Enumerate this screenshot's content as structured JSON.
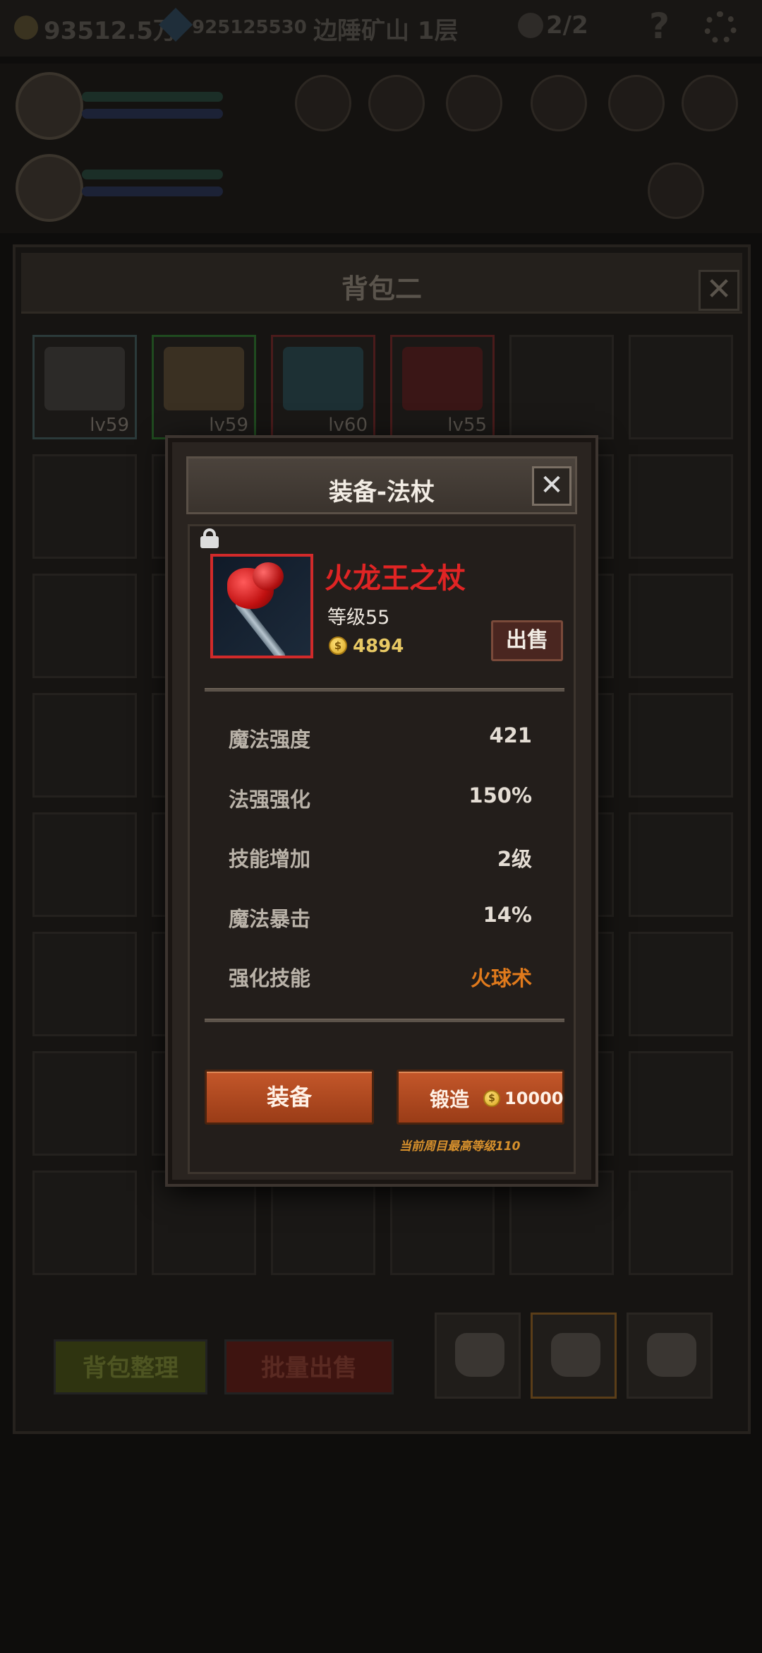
{
  "topbar": {
    "gold": "93512.5万",
    "gems": "925125530",
    "location": "边陲矿山 1层",
    "skull_count": "2/2",
    "help": "?"
  },
  "bag_panel": {
    "title": "背包二",
    "close": "✕",
    "filled_slots": [
      {
        "level": "lv59",
        "icon": "gun-icon",
        "rarity_color": "#2b3a3a"
      },
      {
        "level": "lv59",
        "icon": "dice-icon",
        "rarity_color": "#1f4a1f"
      },
      {
        "level": "lv60",
        "icon": "dagger-icon",
        "rarity_color": "#4a1b1b"
      },
      {
        "level": "lv55",
        "icon": "staff-icon",
        "rarity_color": "#4a1b1b"
      }
    ],
    "sort_label": "背包整理",
    "bulk_sell_label": "批量出售"
  },
  "dialog": {
    "title": "装备-法杖",
    "close": "✕",
    "item": {
      "name": "火龙王之杖",
      "level_text": "等级55",
      "price": "4894",
      "rarity_color": "#d12a2a",
      "locked": true
    },
    "sell_label": "出售",
    "stats": [
      {
        "label": "魔法强度",
        "value": "421"
      },
      {
        "label": "法强强化",
        "value": "150%"
      },
      {
        "label": "技能增加",
        "value": "2级"
      },
      {
        "label": "魔法暴击",
        "value": "14%"
      },
      {
        "label": "强化技能",
        "value": "火球术"
      }
    ],
    "equip_label": "装备",
    "forge_label": "锻造",
    "forge_cost": "10000",
    "forge_note": "当前周目最高等级110",
    "coin_glyph": "$"
  }
}
